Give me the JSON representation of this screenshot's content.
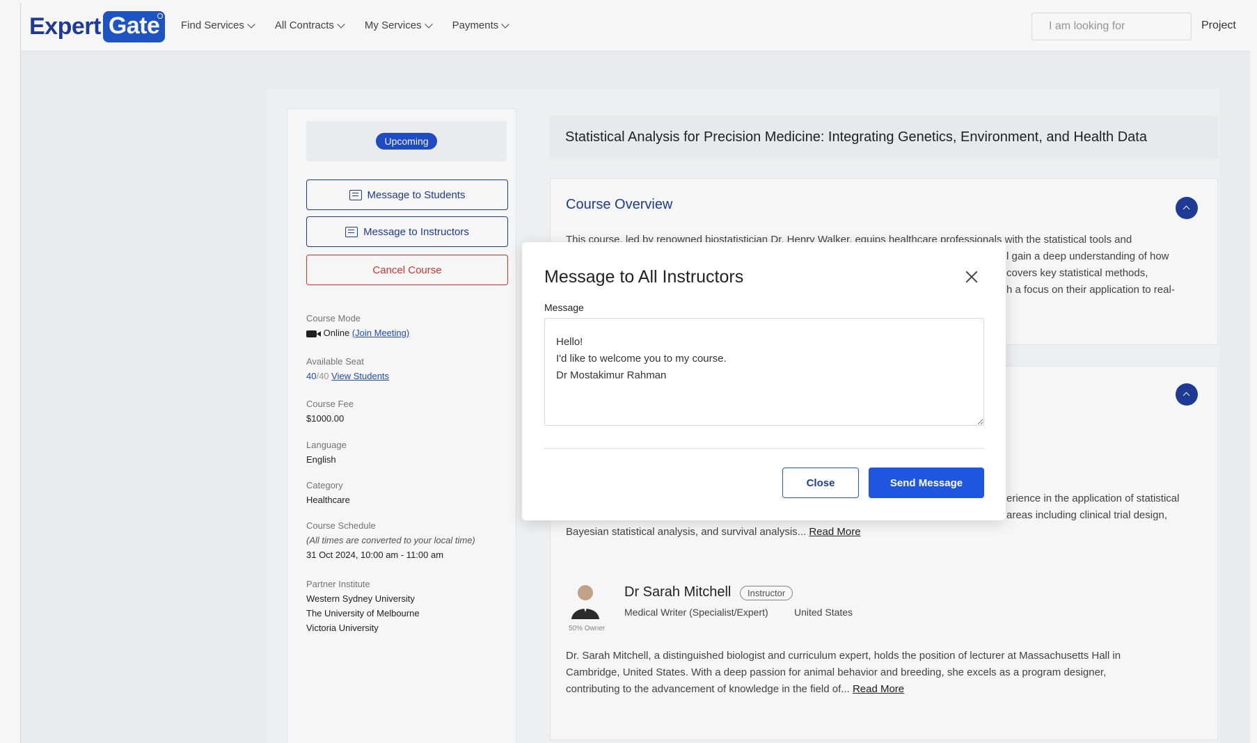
{
  "header": {
    "logo": {
      "part1": "Expert",
      "part2": "Gate"
    },
    "nav": [
      {
        "label": "Find Services"
      },
      {
        "label": "All Contracts"
      },
      {
        "label": "My Services"
      },
      {
        "label": "Payments"
      }
    ],
    "search_placeholder": "I am looking for",
    "project_label": "Project"
  },
  "sidebar": {
    "status_badge": "Upcoming",
    "buttons": {
      "message_students": "Message to Students",
      "message_instructors": "Message to Instructors",
      "cancel_course": "Cancel Course"
    },
    "course_mode": {
      "label": "Course Mode",
      "value": "Online",
      "link": "(Join Meeting)"
    },
    "available_seat": {
      "label": "Available Seat",
      "filled": "40",
      "total": "/40",
      "link": "View Students"
    },
    "course_fee": {
      "label": "Course Fee",
      "value": "$1000.00"
    },
    "language": {
      "label": "Language",
      "value": "English"
    },
    "category": {
      "label": "Category",
      "value": "Healthcare"
    },
    "schedule": {
      "label": "Course Schedule",
      "note": "(All times are converted to your local time)",
      "value": "31 Oct 2024, 10:00 am - 11:00 am"
    },
    "partner": {
      "label": "Partner Institute",
      "items": [
        "Western Sydney University",
        "The University of Melbourne",
        "Victoria University"
      ]
    }
  },
  "main": {
    "course_title": "Statistical Analysis for Precision Medicine: Integrating Genetics, Environment, and Health Data",
    "overview": {
      "title": "Course Overview",
      "lines": [
        "This course, led by renowned biostatistician Dr. Henry Walker, equips healthcare professionals with the statistical tools and",
        "l gain a deep understanding of how",
        "covers key statistical methods,",
        "h a focus on their application to real-"
      ]
    },
    "instructor_section": {
      "lines": [
        "erience in the application of statistical",
        "areas including clinical trial design,",
        "Bayesian statistical analysis, and survival analysis..."
      ],
      "read_more": "Read More"
    },
    "instructor": {
      "name": "Dr Sarah Mitchell",
      "role_badge": "Instructor",
      "owner_caption": "50% Owner",
      "specialty": "Medical Writer (Specialist/Expert)",
      "country": "United States",
      "bio_lines": [
        "Dr. Sarah Mitchell, a distinguished biologist and curriculum expert, holds the position of lecturer at Massachusetts Hall in",
        "Cambridge, United States. With a deep passion for animal behavior and breeding, she excels as a program designer,",
        "contributing to the advancement of knowledge in the field of..."
      ],
      "read_more": "Read More"
    }
  },
  "modal": {
    "title": "Message to All Instructors",
    "message_label": "Message",
    "message_value": "Hello!\nI'd like to welcome you to my course.\nDr Mostakimur Rahman",
    "close_label": "Close",
    "send_label": "Send Message"
  },
  "colors": {
    "brand": "#1f3c99",
    "accent": "#1f56e0",
    "danger": "#dd3333"
  }
}
